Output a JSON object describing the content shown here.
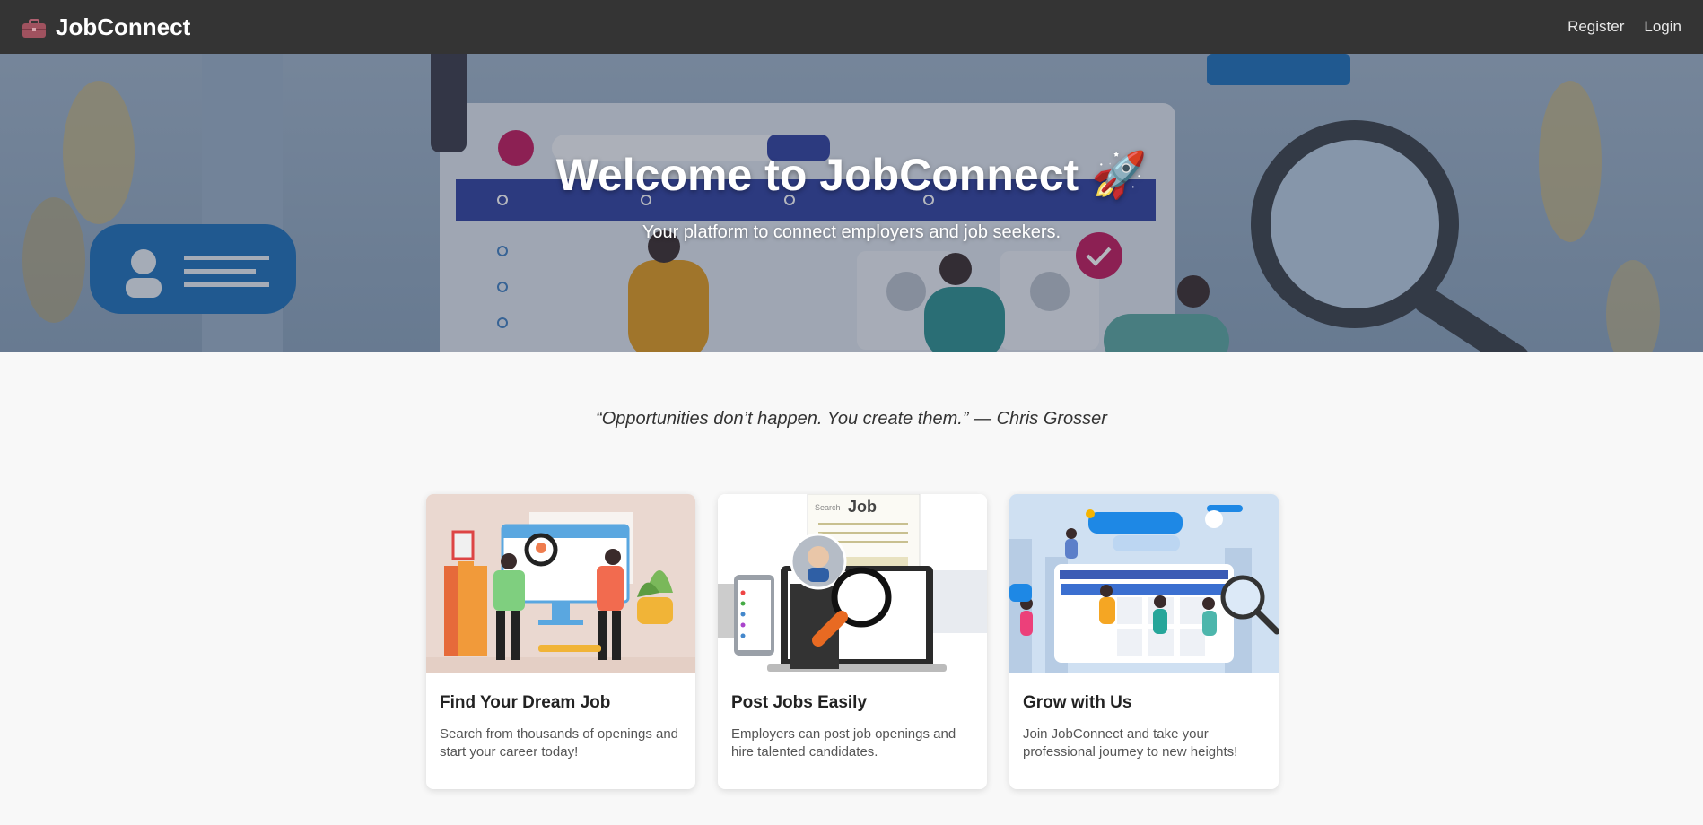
{
  "navbar": {
    "brand_icon": "briefcase-icon",
    "brand": "JobConnect",
    "links": [
      {
        "label": "Register"
      },
      {
        "label": "Login"
      }
    ]
  },
  "hero": {
    "title": "Welcome to JobConnect 🚀",
    "subtitle": "Your platform to connect employers and job seekers."
  },
  "quote": "“Opportunities don’t happen. You create them.” — Chris Grosser",
  "cards": [
    {
      "title": "Find Your Dream Job",
      "text": "Search from thousands of openings and start your career today!",
      "illustration": "job-search-illustration"
    },
    {
      "title": "Post Jobs Easily",
      "text": "Employers can post job openings and hire talented candidates.",
      "illustration": "job-post-illustration",
      "image_text": "Job",
      "image_search": "Search"
    },
    {
      "title": "Grow with Us",
      "text": "Join JobConnect and take your professional journey to new heights!",
      "illustration": "growth-illustration"
    }
  ],
  "colors": {
    "navbar": "#343434",
    "hero_blue": "#2f3f9e",
    "accent_pink": "#c2185b",
    "card_bg": "#ffffff"
  }
}
